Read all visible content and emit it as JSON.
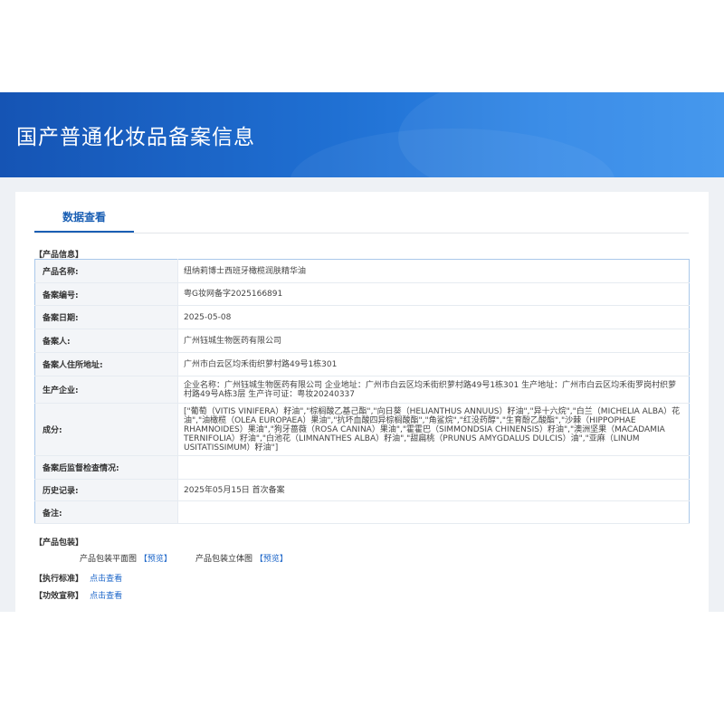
{
  "page": {
    "title": "国产普通化妆品备案信息",
    "tab_label": "数据查看"
  },
  "product_info": {
    "section_label": "【产品信息】",
    "rows": [
      {
        "label": "产品名称:",
        "value": "纽纳莉博士西班牙橄榄润肤精华油"
      },
      {
        "label": "备案编号:",
        "value": "粤G妆网备字2025166891"
      },
      {
        "label": "备案日期:",
        "value": "2025-05-08"
      },
      {
        "label": "备案人:",
        "value": "广州钰城生物医药有限公司"
      },
      {
        "label": "备案人住所地址:",
        "value": "广州市白云区均禾街织萝村路49号1栋301"
      },
      {
        "label": "生产企业:",
        "value": "企业名称：广州钰城生物医药有限公司 企业地址：广州市白云区均禾街织萝村路49号1栋301 生产地址：广州市白云区均禾街罗岗村织萝村路49号A栋3层 生产许可证：粤妆20240337"
      },
      {
        "label": "成分:",
        "value": "[\"葡萄（VITIS VINIFERA）籽油\",\"棕榈酸乙基己酯\",\"向日葵（HELIANTHUS ANNUUS）籽油\",\"异十六烷\",\"白兰（MICHELIA ALBA）花油\",\"油橄榄（OLEA EUROPAEA）果油\",\"抗坏血酸四异棕榈酸酯\",\"角鲨烷\",\"红没药醇\",\"生育酚乙酸酯\",\"沙棘（HIPPOPHAE RHAMNOIDES）果油\",\"狗牙蔷薇（ROSA CANINA）果油\",\"霍霍巴（SIMMONDSIA CHINENSIS）籽油\",\"澳洲坚果（MACADAMIA TERNIFOLIA）籽油\",\"白池花（LIMNANTHES ALBA）籽油\",\"甜扁桃（PRUNUS AMYGDALUS DULCIS）油\",\"亚麻（LINUM USITATISSIMUM）籽油\"]"
      },
      {
        "label": "备案后监督检查情况:",
        "value": ""
      },
      {
        "label": "历史记录:",
        "value": "2025年05月15日 首次备案"
      },
      {
        "label": "备注:",
        "value": ""
      }
    ]
  },
  "packaging": {
    "section_label": "【产品包装】",
    "flat_label": "产品包装平面图",
    "flat_link": "【预览】",
    "stereo_label": "产品包装立体图",
    "stereo_link": "【预览】"
  },
  "standard": {
    "label": "【执行标准】",
    "link": "点击查看"
  },
  "efficacy": {
    "label": "【功效宣称】",
    "link": "点击查看"
  }
}
